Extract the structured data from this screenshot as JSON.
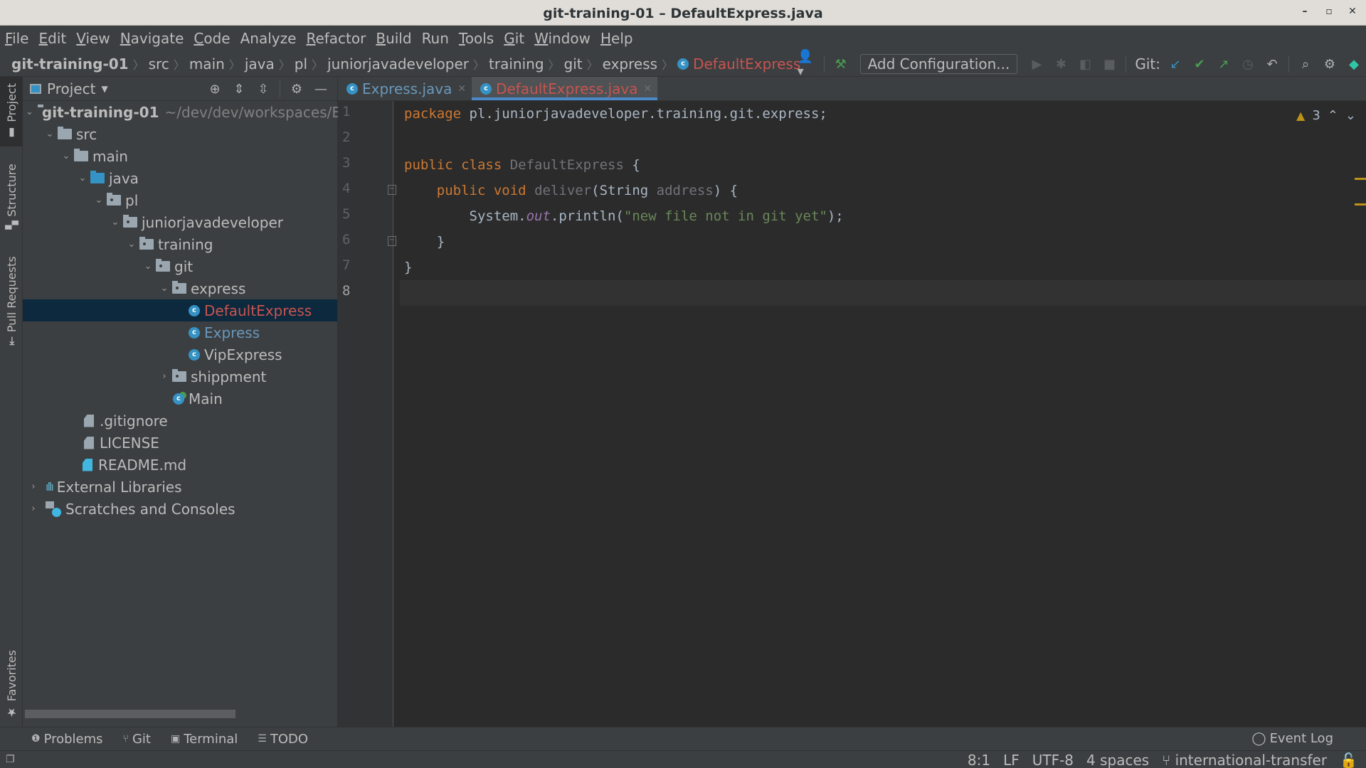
{
  "window": {
    "title": "git-training-01 – DefaultExpress.java",
    "controls": {
      "minimize": "–",
      "maximize": "▫",
      "close": "✕"
    }
  },
  "menu": [
    {
      "label": "File",
      "mnemonic": "F",
      "rest": "ile"
    },
    {
      "label": "Edit",
      "mnemonic": "E",
      "rest": "dit"
    },
    {
      "label": "View",
      "mnemonic": "V",
      "rest": "iew"
    },
    {
      "label": "Navigate",
      "mnemonic": "N",
      "rest": "avigate"
    },
    {
      "label": "Code",
      "mnemonic": "C",
      "rest": "ode"
    },
    {
      "label": "Analyze",
      "mnemonic": "",
      "rest": "Analyze"
    },
    {
      "label": "Refactor",
      "mnemonic": "R",
      "rest": "efactor"
    },
    {
      "label": "Build",
      "mnemonic": "B",
      "rest": "uild"
    },
    {
      "label": "Run",
      "mnemonic": "",
      "rest": "Run"
    },
    {
      "label": "Tools",
      "mnemonic": "T",
      "rest": "ools"
    },
    {
      "label": "Git",
      "mnemonic": "G",
      "rest": "it"
    },
    {
      "label": "Window",
      "mnemonic": "W",
      "rest": "indow"
    },
    {
      "label": "Help",
      "mnemonic": "H",
      "rest": "elp"
    }
  ],
  "breadcrumb": [
    "git-training-01",
    "src",
    "main",
    "java",
    "pl",
    "juniorjavadeveloper",
    "training",
    "git",
    "express",
    "DefaultExpress"
  ],
  "toolbar": {
    "add_configuration": "Add Configuration...",
    "git_label": "Git:",
    "icons": [
      "user-icon",
      "build-hammer-icon",
      "run-icon",
      "debug-icon",
      "coverage-icon",
      "stop-icon",
      "git-update-icon",
      "git-commit-icon",
      "git-push-icon",
      "git-history-icon",
      "git-rollback-icon",
      "search-icon",
      "settings-icon",
      "toolbox-icon"
    ]
  },
  "left_stripe": {
    "project": "Project",
    "structure": "Structure",
    "pull_requests": "Pull Requests",
    "favorites": "Favorites"
  },
  "project_panel": {
    "title": "Project",
    "tree": [
      {
        "label": "git-training-01",
        "path": "~/dev/dev/workspaces/E",
        "type": "module",
        "expanded": true
      },
      {
        "label": "src",
        "type": "folder",
        "expanded": true
      },
      {
        "label": "main",
        "type": "folder",
        "expanded": true
      },
      {
        "label": "java",
        "type": "source-folder",
        "expanded": true
      },
      {
        "label": "pl",
        "type": "package",
        "expanded": true
      },
      {
        "label": "juniorjavadeveloper",
        "type": "package",
        "expanded": true
      },
      {
        "label": "training",
        "type": "package",
        "expanded": true
      },
      {
        "label": "git",
        "type": "package",
        "expanded": true
      },
      {
        "label": "express",
        "type": "package",
        "expanded": true
      },
      {
        "label": "DefaultExpress",
        "type": "class",
        "status": "unversioned",
        "selected": true
      },
      {
        "label": "Express",
        "type": "class",
        "status": "modified"
      },
      {
        "label": "VipExpress",
        "type": "class"
      },
      {
        "label": "shippment",
        "type": "package",
        "expanded": false
      },
      {
        "label": "Main",
        "type": "main-class"
      },
      {
        "label": ".gitignore",
        "type": "file"
      },
      {
        "label": "LICENSE",
        "type": "file"
      },
      {
        "label": "README.md",
        "type": "markdown"
      },
      {
        "label": "External Libraries",
        "type": "libraries",
        "expanded": false
      },
      {
        "label": "Scratches and Consoles",
        "type": "scratches",
        "expanded": false
      }
    ]
  },
  "editor": {
    "tabs": [
      {
        "label": "Express.java",
        "active": false
      },
      {
        "label": "DefaultExpress.java",
        "active": true
      }
    ],
    "line_numbers": [
      "1",
      "2",
      "3",
      "4",
      "5",
      "6",
      "7",
      "8"
    ],
    "current_line": 8,
    "inspection": {
      "warnings": "3"
    },
    "code": {
      "l1_kw": "package",
      "l1_rest": " pl.juniorjavadeveloper.training.git.express;",
      "l3_kw": "public class",
      "l3_name": "DefaultExpress",
      "l3_rest": " {",
      "l4_indent": "    ",
      "l4_kw": "public void",
      "l4_name": "deliver",
      "l4_paren": "(String ",
      "l4_param": "address",
      "l4_rest": ") {",
      "l5_indent": "        System.",
      "l5_field": "out",
      "l5_mid": ".println(",
      "l5_str": "\"new file not in git yet\"",
      "l5_rest": ");",
      "l6": "    }",
      "l7": "}"
    }
  },
  "bottom_tools": [
    {
      "label": "Problems",
      "icon": "problems-icon"
    },
    {
      "label": "Git",
      "icon": "git-icon"
    },
    {
      "label": "Terminal",
      "icon": "terminal-icon"
    },
    {
      "label": "TODO",
      "icon": "todo-icon"
    }
  ],
  "event_log": "Event Log",
  "status": {
    "position": "8:1",
    "line_separator": "LF",
    "encoding": "UTF-8",
    "indent": "4 spaces",
    "branch": "international-transfer"
  },
  "colors": {
    "accent": "#4a88c7",
    "unversioned": "#c75450",
    "modified": "#6897bb",
    "warning": "#be9117"
  }
}
